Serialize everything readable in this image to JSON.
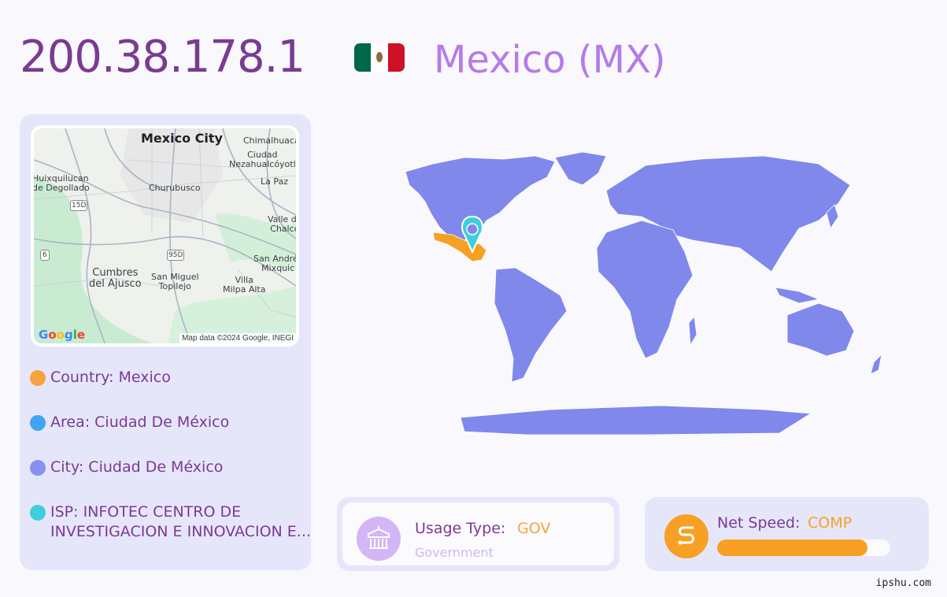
{
  "header": {
    "ip": "200.38.178.1",
    "country_title": "Mexico (MX)",
    "flag_icon": "mexico-flag-icon"
  },
  "map": {
    "labels": {
      "mexico_city": "Mexico City",
      "chimalhuacan": "Chimalhuacá",
      "ciudad_neza": "Ciudad\nNezahualcóyotl",
      "huixquilucan": "Huixquilucan\nde Degollado",
      "churubusco": "Churubusco",
      "la_paz": "La Paz",
      "valle_chalco": "Valle de\nChalco",
      "cumbres": "Cumbres\ndel Ajusco",
      "san_miguel": "San Miguel\nTopilejo",
      "villa_milpa": "Villa\nMilpa Alta",
      "san_andres": "San Andrés\nMixquic",
      "road_15d": "15D",
      "road_95d": "95D",
      "road_6": "6"
    },
    "google_logo": "Google",
    "attribution": "Map data ©2024 Google, INEGI"
  },
  "info": {
    "country": "Country: Mexico",
    "area": "Area: Ciudad De México",
    "city": "City: Ciudad De México",
    "isp": "ISP: INFOTEC CENTRO DE INVESTIGACION E INNOVACION E..."
  },
  "colors": {
    "country_dot": "#f7a23c",
    "area_dot": "#3fa5f2",
    "city_dot": "#8891ee",
    "isp_dot": "#3ccfdc",
    "world_land": "#8088ec",
    "highlight_country": "#f7a023",
    "pin": "#3ccfdc"
  },
  "usage": {
    "label": "Usage Type:",
    "value": "GOV",
    "description": "Government",
    "icon": "government-building-icon"
  },
  "speed": {
    "label": "Net Speed:",
    "value": "COMP",
    "level": 0.87,
    "icon": "speed-road-icon"
  },
  "footer": "ipshu.com"
}
